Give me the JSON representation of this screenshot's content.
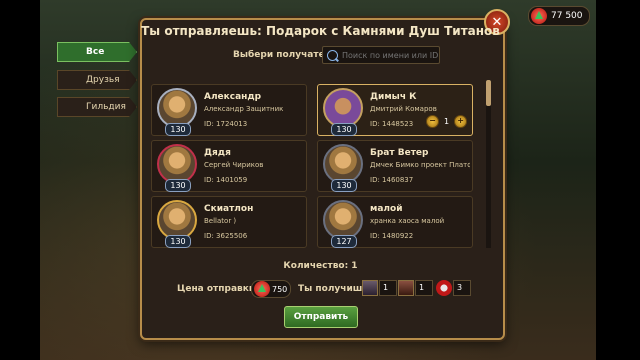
{
  "title": "Ты отправляешь: Подарок с Камнями Душ Титанов",
  "currency": {
    "icon": "emerald-icon",
    "amount": "77 500"
  },
  "receiver_label": "Выбери получателя",
  "search_placeholder": "Поиск по имени или ID",
  "tabs": [
    {
      "label": "Все",
      "active": true
    },
    {
      "label": "Друзья",
      "active": false
    },
    {
      "label": "Гильдия",
      "active": false
    }
  ],
  "players": [
    {
      "name": "Александр",
      "sub": "Александр Защитник",
      "id": "ID: 1724013",
      "level": "130"
    },
    {
      "name": "Димыч К",
      "sub": "Дмитрий Комаров",
      "id": "ID: 1448523",
      "level": "130",
      "selected": true,
      "qty": "1"
    },
    {
      "name": "Дядя",
      "sub": "Сергей Чириков",
      "id": "ID: 1401059",
      "level": "130"
    },
    {
      "name": "Брат Ветер",
      "sub": "Дмчек Бимко проект Платформ",
      "id": "ID: 1460837",
      "level": "130"
    },
    {
      "name": "Скиатлон",
      "sub": "Bellator )",
      "id": "ID: 3625506",
      "level": "130"
    },
    {
      "name": "малой",
      "sub": "хранка хаоса малой",
      "id": "ID: 1480922",
      "level": "127"
    }
  ],
  "count_label": "Количество: 1",
  "price_label": "Цена отправки:",
  "price_value": "750",
  "get_label": "Ты получишь:",
  "rewards": [
    {
      "count": "1"
    },
    {
      "count": "1"
    },
    {
      "count": "3"
    }
  ],
  "send_label": "Отправить",
  "accent": "#2f6e2c"
}
